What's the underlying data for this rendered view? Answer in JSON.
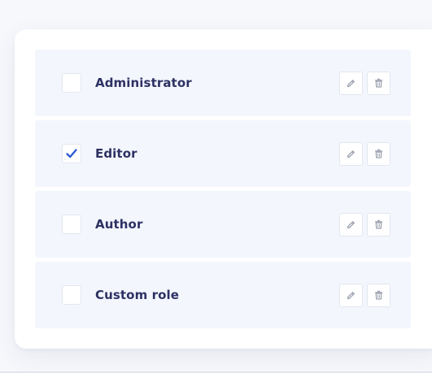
{
  "roles": [
    {
      "label": "Administrator",
      "checked": false,
      "edit_icon": "pencil-icon",
      "delete_icon": "trash-icon"
    },
    {
      "label": "Editor",
      "checked": true,
      "edit_icon": "pencil-icon",
      "delete_icon": "trash-icon"
    },
    {
      "label": "Author",
      "checked": false,
      "edit_icon": "pencil-icon",
      "delete_icon": "trash-icon"
    },
    {
      "label": "Custom role",
      "checked": false,
      "edit_icon": "pencil-icon",
      "delete_icon": "trash-icon"
    }
  ],
  "colors": {
    "card_bg": "#ffffff",
    "row_bg": "#f3f6fd",
    "label_text": "#2d3163",
    "check_accent": "#2f5bd3",
    "icon_gray": "#9aa0ae"
  }
}
